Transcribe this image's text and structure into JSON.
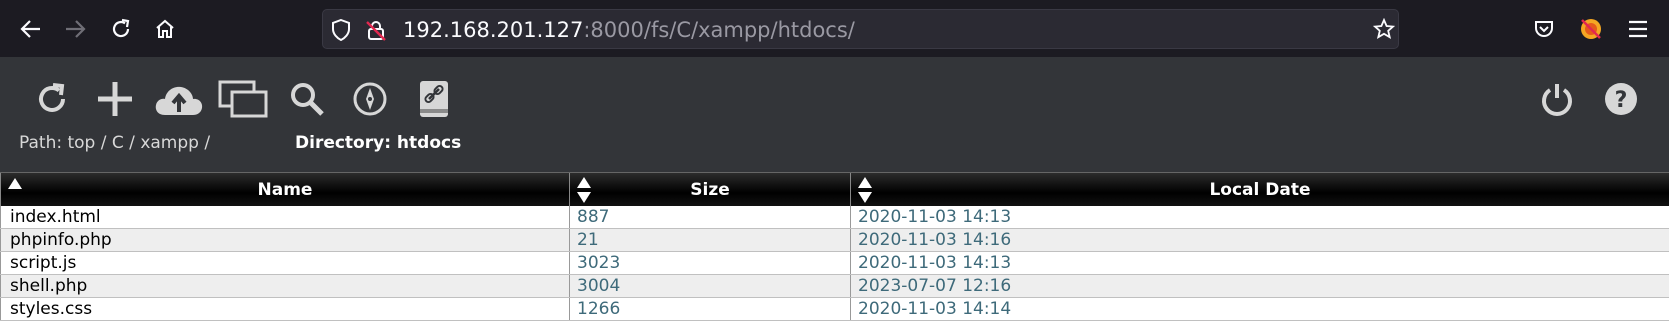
{
  "browser": {
    "url_host": "192.168.201.127",
    "url_rest": ":8000/fs/C/xampp/htdocs/",
    "icons": [
      "back-arrow-icon",
      "forward-arrow-icon",
      "reload-icon",
      "home-icon",
      "shield-icon",
      "insecure-lock-icon",
      "bookmark-star-icon",
      "pocket-icon",
      "extension-avatar-icon",
      "hamburger-menu-icon"
    ]
  },
  "toolbar": {
    "icons": [
      "refresh-icon",
      "add-icon",
      "upload-cloud-icon",
      "windows-icon",
      "search-icon",
      "compass-icon",
      "link-device-icon",
      "power-icon",
      "help-icon"
    ]
  },
  "breadcrumb": {
    "prefix": "Path:",
    "segments": [
      "top",
      "C",
      "xampp"
    ],
    "separator": "/",
    "directory_label": "Directory: htdocs"
  },
  "table": {
    "columns": [
      "Name",
      "Size",
      "Local Date"
    ],
    "rows": [
      {
        "name": "index.html",
        "size": "887",
        "date": "2020-11-03 14:13"
      },
      {
        "name": "phpinfo.php",
        "size": "21",
        "date": "2020-11-03 14:16"
      },
      {
        "name": "script.js",
        "size": "3023",
        "date": "2020-11-03 14:13"
      },
      {
        "name": "shell.php",
        "size": "3004",
        "date": "2023-07-07 12:16"
      },
      {
        "name": "styles.css",
        "size": "1266",
        "date": "2020-11-03 14:14"
      }
    ]
  }
}
